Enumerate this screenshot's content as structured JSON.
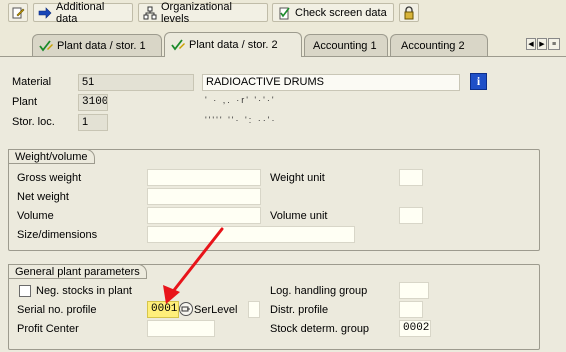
{
  "toolbar": {
    "additional_data_label": "Additional data",
    "org_levels_label": "Organizational levels",
    "check_screen_label": "Check screen data"
  },
  "tabs": [
    {
      "label": "Plant data / stor. 1"
    },
    {
      "label": "Plant data / stor. 2"
    },
    {
      "label": "Accounting 1"
    },
    {
      "label": "Accounting 2"
    }
  ],
  "header": {
    "material_label": "Material",
    "material_value": "51",
    "material_desc": "RADIOACTIVE DRUMS",
    "plant_label": "Plant",
    "plant_value": "3100",
    "plant_desc": "' · ,.  ·r'  '·'·'",
    "storloc_label": "Stor. loc.",
    "storloc_value": "1",
    "storloc_desc": "''''' ''·  ':  ··'·"
  },
  "weight": {
    "title": "Weight/volume",
    "gross_label": "Gross weight",
    "net_label": "Net weight",
    "volume_label": "Volume",
    "size_label": "Size/dimensions",
    "weight_unit_label": "Weight unit",
    "volume_unit_label": "Volume unit"
  },
  "plant_params": {
    "title": "General plant parameters",
    "neg_stocks_label": "Neg. stocks in plant",
    "serial_label": "Serial no. profile",
    "serial_value": "0001",
    "serlevel_label": "SerLevel",
    "profit_label": "Profit Center",
    "log_group_label": "Log. handling group",
    "distr_label": "Distr. profile",
    "stock_group_label": "Stock determ. group",
    "stock_group_value": "0002"
  },
  "colors": {
    "annotation_arrow": "#e8141a",
    "serial_highlight": "#ffef7a"
  }
}
